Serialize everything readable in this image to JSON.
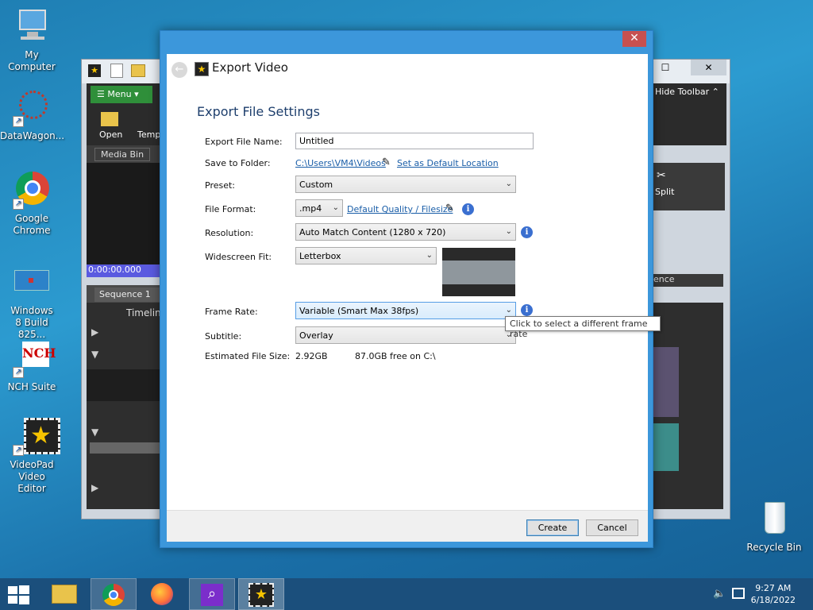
{
  "desktop": {
    "icons": [
      {
        "label": "My Computer"
      },
      {
        "label": "DataWagon..."
      },
      {
        "label": "Google Chrome"
      },
      {
        "label": "Windows 8 Build 825..."
      },
      {
        "label": "NCH Suite"
      },
      {
        "label": "VideoPad Video Editor"
      },
      {
        "label": "Recycle Bin"
      }
    ]
  },
  "bgapp": {
    "menu_label": "Menu",
    "open_label": "Open",
    "temp_label": "Temp",
    "media_bin_tab": "Media Bin",
    "timecode": "0:00:00.000",
    "sequence_tab": "Sequence 1",
    "timeline_label": "Timelin",
    "hide_toolbar_label": "Hide Toolbar",
    "split_label": "Split",
    "ence_label": "ence"
  },
  "dialog": {
    "title": "Export Video",
    "heading": "Export File Settings",
    "fields": {
      "file_name_label": "Export File Name:",
      "file_name_value": "Untitled",
      "folder_label": "Save to Folder:",
      "folder_value": "C:\\Users\\VM4\\Videos",
      "set_default_link": "Set as Default Location",
      "preset_label": "Preset:",
      "preset_value": "Custom",
      "format_label": "File Format:",
      "format_value": ".mp4",
      "quality_link": "Default Quality / Filesize",
      "resolution_label": "Resolution:",
      "resolution_value": "Auto Match Content (1280 x 720)",
      "widescreen_label": "Widescreen Fit:",
      "widescreen_value": "Letterbox",
      "framerate_label": "Frame Rate:",
      "framerate_value": "Variable (Smart Max 38fps)",
      "subtitle_label": "Subtitle:",
      "subtitle_value": "Overlay",
      "size_label": "Estimated File Size:",
      "size_value": "2.92GB",
      "free_value": "87.0GB free on C:\\"
    },
    "tooltip": "Click to select a different frame rate",
    "create_label": "Create",
    "cancel_label": "Cancel",
    "close_glyph": "✕"
  },
  "taskbar": {
    "time": "9:27 AM",
    "date": "6/18/2022"
  },
  "colors": {
    "dialog_frame": "#3c97db",
    "link": "#1a5ea8",
    "info_icon": "#3a6fd0",
    "taskbar": "#1b4f7c"
  }
}
